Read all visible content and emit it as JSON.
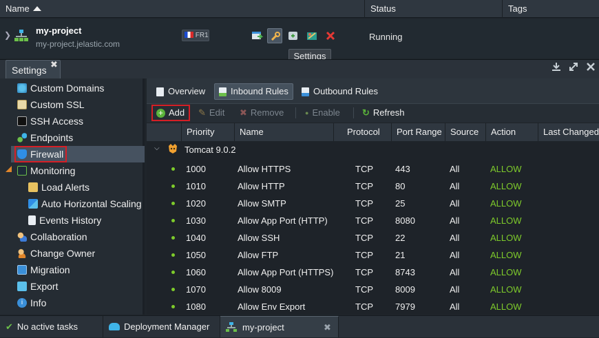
{
  "grid_header": {
    "name": "Name",
    "status": "Status",
    "tags": "Tags"
  },
  "env": {
    "name": "my-project",
    "url": "my-project.jelastic.com",
    "region": "FR1",
    "status": "Running"
  },
  "tooltip": "Settings",
  "settings_tab": {
    "label": "Settings"
  },
  "sidebar": {
    "items": [
      {
        "label": "Custom Domains"
      },
      {
        "label": "Custom SSL"
      },
      {
        "label": "SSH Access"
      },
      {
        "label": "Endpoints"
      },
      {
        "label": "Firewall"
      },
      {
        "label": "Monitoring"
      },
      {
        "label": "Load Alerts"
      },
      {
        "label": "Auto Horizontal Scaling"
      },
      {
        "label": "Events History"
      },
      {
        "label": "Collaboration"
      },
      {
        "label": "Change Owner"
      },
      {
        "label": "Migration"
      },
      {
        "label": "Export"
      },
      {
        "label": "Info"
      }
    ]
  },
  "subtabs": {
    "overview": "Overview",
    "inbound": "Inbound Rules",
    "outbound": "Outbound Rules"
  },
  "toolbar": {
    "add": "Add",
    "edit": "Edit",
    "remove": "Remove",
    "enable": "Enable",
    "refresh": "Refresh"
  },
  "table": {
    "columns": [
      "Priority",
      "Name",
      "Protocol",
      "Port Range",
      "Source",
      "Action",
      "Last Changed"
    ],
    "group": "Tomcat 9.0.2",
    "rows": [
      [
        "1000",
        "Allow HTTPS",
        "TCP",
        "443",
        "All",
        "ALLOW"
      ],
      [
        "1010",
        "Allow HTTP",
        "TCP",
        "80",
        "All",
        "ALLOW"
      ],
      [
        "1020",
        "Allow SMTP",
        "TCP",
        "25",
        "All",
        "ALLOW"
      ],
      [
        "1030",
        "Allow App Port (HTTP)",
        "TCP",
        "8080",
        "All",
        "ALLOW"
      ],
      [
        "1040",
        "Allow SSH",
        "TCP",
        "22",
        "All",
        "ALLOW"
      ],
      [
        "1050",
        "Allow FTP",
        "TCP",
        "21",
        "All",
        "ALLOW"
      ],
      [
        "1060",
        "Allow App Port (HTTPS)",
        "TCP",
        "8743",
        "All",
        "ALLOW"
      ],
      [
        "1070",
        "Allow 8009",
        "TCP",
        "8009",
        "All",
        "ALLOW"
      ],
      [
        "1080",
        "Allow Env Export",
        "TCP",
        "7979",
        "All",
        "ALLOW"
      ]
    ]
  },
  "bottom": {
    "tasks": "No active tasks",
    "deploy": "Deployment Manager",
    "project": "my-project"
  },
  "colors": {
    "accent_green": "#7ecb2b",
    "highlight_red": "#d61f26",
    "selection": "#465260"
  }
}
